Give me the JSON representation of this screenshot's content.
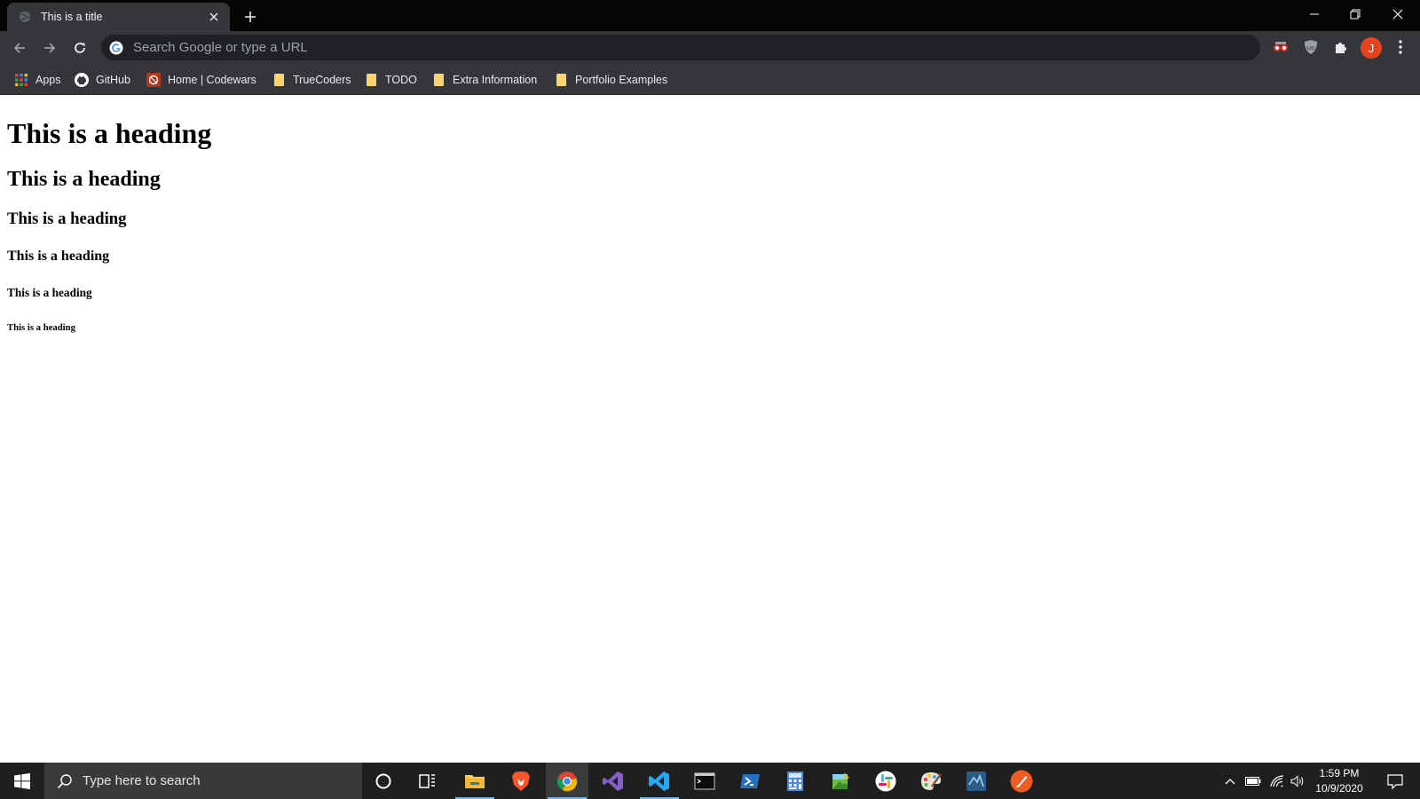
{
  "tab": {
    "title": "This is a title"
  },
  "omnibox": {
    "placeholder": "Search Google or type a URL"
  },
  "avatar": {
    "initial": "J",
    "color": "#e8431f"
  },
  "bookmarks": [
    {
      "label": "Apps",
      "icon": "apps-grid-icon"
    },
    {
      "label": "GitHub",
      "icon": "github-icon"
    },
    {
      "label": "Home | Codewars",
      "icon": "codewars-icon"
    },
    {
      "label": "TrueCoders",
      "icon": "folder-icon"
    },
    {
      "label": "TODO",
      "icon": "folder-icon"
    },
    {
      "label": "Extra Information",
      "icon": "folder-icon"
    },
    {
      "label": "Portfolio Examples",
      "icon": "folder-icon"
    }
  ],
  "page": {
    "headings": [
      "This is a heading",
      "This is a heading",
      "This is a heading",
      "This is a heading",
      "This is a heading",
      "This is a heading"
    ]
  },
  "taskbar": {
    "search_placeholder": "Type here to search",
    "apps": [
      "cortana-icon",
      "task-view-icon",
      "file-explorer-icon",
      "brave-icon",
      "chrome-icon",
      "visual-studio-icon",
      "vscode-icon",
      "terminal-icon",
      "powershell-icon",
      "calculator-icon",
      "paint-icon",
      "slack-icon",
      "paint-palette-icon",
      "mysql-workbench-icon",
      "postman-icon"
    ],
    "time": "1:59 PM",
    "date": "10/9/2020"
  },
  "colors": {
    "tab_strip": "#050505",
    "toolbar": "#35363a",
    "omnibox": "#202124",
    "taskbar": "#1f1f1f",
    "folder": "#fbd46d"
  }
}
